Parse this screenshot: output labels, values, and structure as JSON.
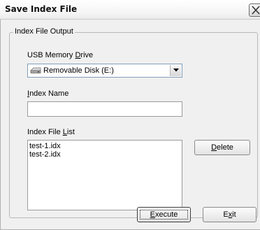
{
  "window": {
    "title": "Save Index File"
  },
  "group": {
    "legend": "Index File Output"
  },
  "drive": {
    "label_pre": "USB Memory ",
    "label_key": "D",
    "label_post": "rive",
    "selected": "Removable Disk (E:)",
    "icon": "removable-disk-icon"
  },
  "index_name": {
    "label_key": "I",
    "label_post": "ndex Name",
    "value": ""
  },
  "file_list": {
    "label_pre": "Index File ",
    "label_key": "L",
    "label_post": "ist",
    "items": [
      "test-1.idx",
      "test-2.idx"
    ]
  },
  "buttons": {
    "delete_key": "D",
    "delete_post": "elete",
    "execute_key": "E",
    "execute_post": "xecute",
    "exit_pre": "E",
    "exit_key": "x",
    "exit_post": "it"
  }
}
